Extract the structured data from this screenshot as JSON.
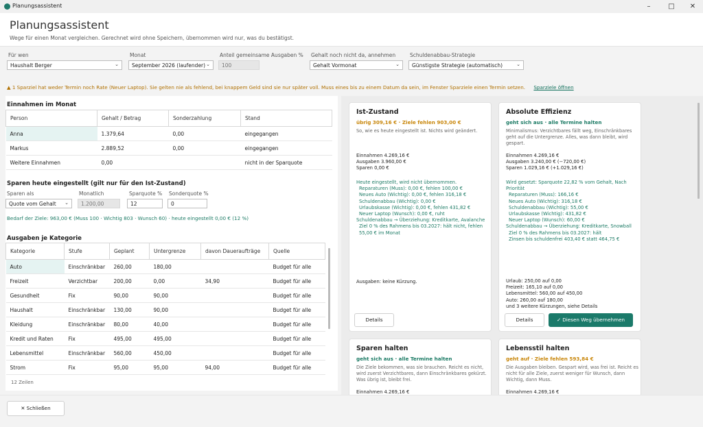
{
  "window": {
    "title": "Planungsassistent"
  },
  "header": {
    "title": "Planungsassistent",
    "subtitle": "Wege für einen Monat vergleichen. Gerechnet wird ohne Speichern, übernommen wird nur, was du bestätigst."
  },
  "filters": {
    "fuer_wen_label": "Für wen",
    "fuer_wen_value": "Haushalt Berger",
    "monat_label": "Monat",
    "monat_value": "September 2026 (laufender)",
    "anteil_label": "Anteil gemeinsame Ausgaben %",
    "anteil_value": "100",
    "gehalt_label": "Gehalt noch nicht da, annehmen",
    "gehalt_value": "Gehalt Vormonat",
    "schulden_label": "Schuldenabbau-Strategie",
    "schulden_value": "Günstigste Strategie (automatisch)"
  },
  "warning": {
    "text": "1 Sparziel hat weder Termin noch Rate (Neuer Laptop). Sie gelten nie als fehlend, bei knappem Geld sind sie nur später voll. Muss eines bis zu einem Datum da sein, im Fenster Sparziele einen Termin setzen.",
    "link": "Sparziele öffnen"
  },
  "income": {
    "title": "Einnahmen im Monat",
    "headers": [
      "Person",
      "Gehalt / Betrag",
      "Sonderzahlung",
      "Stand"
    ],
    "rows": [
      [
        "Anna",
        "1.379,64",
        "0,00",
        "eingegangen"
      ],
      [
        "Markus",
        "2.889,52",
        "0,00",
        "eingegangen"
      ],
      [
        "Weitere Einnahmen",
        "0,00",
        "",
        "nicht in der Sparquote"
      ]
    ]
  },
  "saving": {
    "title": "Sparen heute eingestellt (gilt nur für den Ist-Zustand)",
    "sparen_als_label": "Sparen als",
    "sparen_als_value": "Quote vom Gehalt",
    "monatlich_label": "Monatlich",
    "monatlich_value": "1.200,00",
    "sparquote_label": "Sparquote %",
    "sparquote_value": "12",
    "sonderquote_label": "Sonderquote %",
    "sonderquote_value": "0",
    "bedarf": "Bedarf der Ziele: 963,00 € (Muss 100 · Wichtig 803 · Wunsch 60) · heute eingestellt 0,00 € (12 %)"
  },
  "expenses": {
    "title": "Ausgaben je Kategorie",
    "headers": [
      "Kategorie",
      "Stufe",
      "Geplant",
      "Untergrenze",
      "davon Daueraufträge",
      "Quelle"
    ],
    "rows": [
      [
        "Auto",
        "Einschränkbar",
        "260,00",
        "180,00",
        "",
        "Budget für alle"
      ],
      [
        "Freizeit",
        "Verzichtbar",
        "200,00",
        "0,00",
        "34,90",
        "Budget für alle"
      ],
      [
        "Gesundheit",
        "Fix",
        "90,00",
        "90,00",
        "",
        "Budget für alle"
      ],
      [
        "Haushalt",
        "Einschränkbar",
        "130,00",
        "90,00",
        "",
        "Budget für alle"
      ],
      [
        "Kleidung",
        "Einschränkbar",
        "80,00",
        "40,00",
        "",
        "Budget für alle"
      ],
      [
        "Kredit und Raten",
        "Fix",
        "495,00",
        "495,00",
        "",
        "Budget für alle"
      ],
      [
        "Lebensmittel",
        "Einschränkbar",
        "560,00",
        "450,00",
        "",
        "Budget für alle"
      ],
      [
        "Strom",
        "Fix",
        "95,00",
        "95,00",
        "94,00",
        "Budget für alle"
      ]
    ],
    "count": "12 Zeilen"
  },
  "cards": {
    "ist": {
      "title": "Ist-Zustand",
      "status": "übrig 309,16 € · Ziele fehlen 903,00 €",
      "status_color": "#c8860a",
      "desc": "So, wie es heute eingestellt ist. Nichts wird geändert.",
      "numbers": [
        "Einnahmen 4.269,16 €",
        "Ausgaben 3.960,00 €",
        "Sparen 0,00 €"
      ],
      "details": [
        "Heute eingestellt, wird nicht übernommen.",
        "  Reparaturen (Muss): 0,00 €, fehlen 100,00 €",
        "  Neues Auto (Wichtig): 0,00 €, fehlen 316,18 €",
        "  Schuldenabbau (Wichtig): 0,00 €",
        "  Urlaubskasse (Wichtig): 0,00 €, fehlen 431,82 €",
        "  Neuer Laptop (Wunsch): 0,00 €, ruht",
        "Schuldenabbau → Überziehung: Kreditkarte, Avalanche",
        "  Ziel 0 % des Rahmens bis 03.2027: hält nicht, fehlen",
        "  55,00 € im Monat"
      ],
      "cuts": "Ausgaben: keine Kürzung.",
      "details_btn": "Details"
    },
    "eff": {
      "title": "Absolute Effizienz",
      "status": "geht sich aus · alle Termine halten",
      "status_color": "#1b7a64",
      "desc": "Minimalismus: Verzichtbares fällt weg, Einschränkbares geht auf die Untergrenze. Alles, was dann bleibt, wird gespart.",
      "numbers": [
        "Einnahmen 4.269,16 €",
        "Ausgaben 3.240,00 € (−720,00 €)",
        "Sparen 1.029,16 € (+1.029,16 €)"
      ],
      "details": [
        "Wird gesetzt: Sparquote 22,82 % vom Gehalt, Nach",
        "Priorität",
        "  Reparaturen (Muss): 166,16 €",
        "  Neues Auto (Wichtig): 316,18 €",
        "  Schuldenabbau (Wichtig): 55,00 €",
        "  Urlaubskasse (Wichtig): 431,82 €",
        "  Neuer Laptop (Wunsch): 60,00 €",
        "Schuldenabbau → Überziehung: Kreditkarte, Snowball",
        "  Ziel 0 % des Rahmens bis 03.2027: hält",
        "  Zinsen bis schuldenfrei 403,40 € statt 464,75 €"
      ],
      "cuts": [
        "Urlaub: 250,00 auf 0,00",
        "Freizeit: 165,10 auf 0,00",
        "Lebensmittel: 560,00 auf 450,00",
        "Auto: 260,00 auf 180,00",
        "und 3 weitere Kürzungen, siehe Details"
      ],
      "details_btn": "Details",
      "apply_btn": "Diesen Weg übernehmen"
    },
    "sparen": {
      "title": "Sparen halten",
      "status": "geht sich aus · alle Termine halten",
      "status_color": "#1b7a64",
      "desc": "Die Ziele bekommen, was sie brauchen. Reicht es nicht, wird zuerst Verzichtbares, dann Einschränkbares gekürzt. Was übrig ist, bleibt frei.",
      "numbers": [
        "Einnahmen 4.269,16 €"
      ]
    },
    "leben": {
      "title": "Lebensstil halten",
      "status": "geht auf · Ziele fehlen 593,84 €",
      "status_color": "#c8860a",
      "desc": "Die Ausgaben bleiben. Gespart wird, was frei ist. Reicht es nicht für alle Ziele, zuerst weniger für Wunsch, dann Wichtig, dann Muss.",
      "numbers": [
        "Einnahmen 4.269,16 €"
      ]
    }
  },
  "footer": {
    "close": "Schließen"
  }
}
